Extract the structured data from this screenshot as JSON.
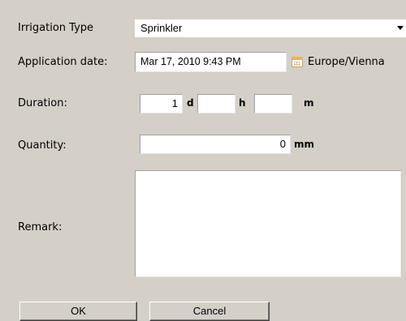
{
  "form": {
    "irrigation_type_label": "Irrigation Type",
    "irrigation_type_value": "Sprinkler",
    "application_date_label": "Application date:",
    "application_date_value": "Mar 17, 2010 9:43 PM",
    "timezone": "Europe/Vienna",
    "duration_label": "Duration:",
    "duration_days": "1",
    "duration_days_unit": "d",
    "duration_hours": "",
    "duration_hours_unit": "h",
    "duration_minutes": "",
    "duration_minutes_unit": "m",
    "quantity_label": "Quantity:",
    "quantity_value": "0",
    "quantity_unit": "mm",
    "remark_label": "Remark:",
    "remark_value": ""
  },
  "buttons": {
    "ok_label": "OK",
    "cancel_label": "Cancel"
  },
  "icons": {
    "calendar": "calendar-icon",
    "dropdown": "chevron-down-icon"
  }
}
